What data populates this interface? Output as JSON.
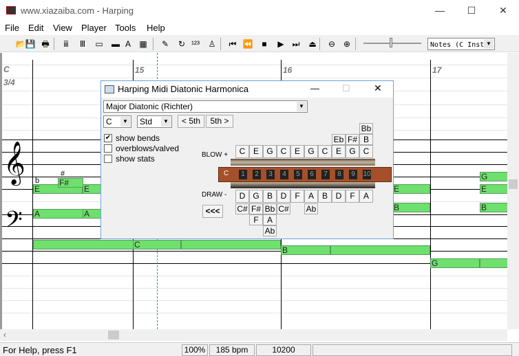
{
  "window": {
    "title": "www.xiazaiba.com - Harping",
    "minimize": "—",
    "maximize": "☐",
    "close": "✕"
  },
  "menu": [
    "File",
    "Edit",
    "View",
    "Player",
    "Tools",
    "Help"
  ],
  "toolbar": {
    "icons": [
      "open-icon",
      "save-icon",
      "print-icon",
      "tuning-icon",
      "piano-icon",
      "harmonica-icon",
      "harmonica-view-icon",
      "text-icon",
      "grid-icon",
      "pencil-icon",
      "loop-icon",
      "numbering-icon",
      "metronome-icon",
      "skip-start-icon",
      "rewind-icon",
      "stop-icon",
      "play-icon",
      "skip-end-icon",
      "eject-icon",
      "zoom-out-icon",
      "zoom-in-icon"
    ],
    "view_select": "Notes (C Inst"
  },
  "score": {
    "key": "C",
    "time": "3/4",
    "measures": [
      "15",
      "16",
      "17"
    ],
    "flat_mark": "b",
    "sharp_mark": "#",
    "notes": [
      "E",
      "F#",
      "E",
      "A",
      "A",
      "C",
      "B",
      "G",
      "G",
      "E",
      "B",
      "E",
      "B"
    ]
  },
  "dialog": {
    "title": "Harping Midi Diatonic Harmonica",
    "tuning": "Major Diatonic (Richter)",
    "key": "C",
    "layout": "Std",
    "fifth_down": "< 5th",
    "fifth_up": "5th >",
    "show_bends": {
      "label": "show bends",
      "checked": true
    },
    "overblows": {
      "label": "overblows/valved",
      "checked": false
    },
    "show_stats": {
      "label": "show stats",
      "checked": false
    },
    "blow_label": "BLOW +",
    "draw_label": "DRAW -",
    "back_button": "<<<",
    "harp_key": "C",
    "holes": [
      "1",
      "2",
      "3",
      "4",
      "5",
      "6",
      "7",
      "8",
      "9",
      "10"
    ],
    "blow": [
      "C",
      "E",
      "G",
      "C",
      "E",
      "G",
      "C",
      "E",
      "G",
      "C"
    ],
    "draw": [
      "D",
      "G",
      "B",
      "D",
      "F",
      "A",
      "B",
      "D",
      "F",
      "A"
    ],
    "blow_bends": [
      {
        "hole": 8,
        "row": 1,
        "note": "Eb"
      },
      {
        "hole": 9,
        "row": 1,
        "note": "F#"
      },
      {
        "hole": 10,
        "row": 1,
        "note": "B"
      },
      {
        "hole": 10,
        "row": 2,
        "note": "Bb"
      }
    ],
    "draw_bends": [
      {
        "hole": 1,
        "row": 1,
        "note": "C#"
      },
      {
        "hole": 2,
        "row": 1,
        "note": "F#"
      },
      {
        "hole": 3,
        "row": 1,
        "note": "Bb"
      },
      {
        "hole": 4,
        "row": 1,
        "note": "C#"
      },
      {
        "hole": 6,
        "row": 1,
        "note": "Ab"
      },
      {
        "hole": 2,
        "row": 2,
        "note": "F"
      },
      {
        "hole": 3,
        "row": 2,
        "note": "A"
      },
      {
        "hole": 3,
        "row": 3,
        "note": "Ab"
      }
    ]
  },
  "status": {
    "help": "For Help, press F1",
    "zoom": "100%",
    "tempo": "185 bpm",
    "position": "10200"
  }
}
